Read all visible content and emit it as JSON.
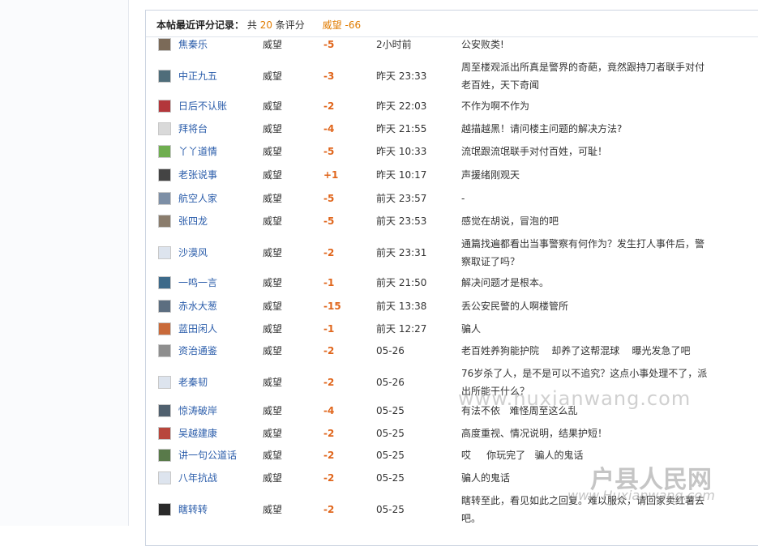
{
  "summary": {
    "label": "本帖最近评分记录：",
    "prefix": "共",
    "count": "20",
    "suffix": "条评分",
    "score_label": "威望",
    "score_total": "-66"
  },
  "records": [
    {
      "user": "焦秦乐",
      "type": "威望",
      "value": "-5",
      "time": "2小时前",
      "reason": "公安败类!",
      "avatar": "#7b6a58"
    },
    {
      "user": "中正九五",
      "type": "威望",
      "value": "-3",
      "time": "昨天 23:33",
      "reason": "周至楼观派出所真是警界的奇葩，竟然跟持刀者联手对付老百姓，天下奇闻",
      "avatar": "#4f6d7a"
    },
    {
      "user": "日后不认账",
      "type": "威望",
      "value": "-2",
      "time": "昨天 22:03",
      "reason": "不作为啊不作为",
      "avatar": "#b3373b"
    },
    {
      "user": "拜将台",
      "type": "威望",
      "value": "-4",
      "time": "昨天 21:55",
      "reason": "越描越黑！请问楼主问题的解决方法?",
      "avatar": "#d9d9d9"
    },
    {
      "user": "丫丫道情",
      "type": "威望",
      "value": "-5",
      "time": "昨天 10:33",
      "reason": "流氓跟流氓联手对付百姓，可耻！",
      "avatar": "#6fae4f"
    },
    {
      "user": "老张说事",
      "type": "威望",
      "value": "+1",
      "time": "昨天 10:17",
      "reason": "声援绪刚观天",
      "avatar": "#444444"
    },
    {
      "user": "航空人家",
      "type": "威望",
      "value": "-5",
      "time": "前天 23:57",
      "reason": "-",
      "avatar": "#7d8fa6"
    },
    {
      "user": "张四龙",
      "type": "威望",
      "value": "-5",
      "time": "前天 23:53",
      "reason": "感觉在胡说，冒泡的吧",
      "avatar": "#8a7c6c"
    },
    {
      "user": "沙漠风",
      "type": "威望",
      "value": "-2",
      "time": "前天 23:31",
      "reason": "通篇找遍都看出当事警察有何作为？发生打人事件后，警察取证了吗？",
      "avatar": "#dde4ee"
    },
    {
      "user": "一鸣一言",
      "type": "威望",
      "value": "-1",
      "time": "前天 21:50",
      "reason": "解决问题才是根本。",
      "avatar": "#3d6a8a"
    },
    {
      "user": "赤水大葱",
      "type": "威望",
      "value": "-15",
      "time": "前天 13:38",
      "reason": "丢公安民警的人啊楼管所",
      "avatar": "#5c6e80"
    },
    {
      "user": "蓝田闲人",
      "type": "威望",
      "value": "-1",
      "time": "前天 12:27",
      "reason": "骗人",
      "avatar": "#c96a3a"
    },
    {
      "user": "资治通鉴",
      "type": "威望",
      "value": "-2",
      "time": "05-26",
      "reason": "老百姓养狗能护院    却养了这帮混球    曝光发急了吧",
      "avatar": "#8e8e8e"
    },
    {
      "user": "老秦韧",
      "type": "威望",
      "value": "-2",
      "time": "05-26",
      "reason": "76岁杀了人，是不是可以不追究？这点小事处理不了，派出所能干什么？",
      "avatar": "#dde4ee"
    },
    {
      "user": "惊涛破岸",
      "type": "威望",
      "value": "-4",
      "time": "05-25",
      "reason": "有法不依   难怪周至这么乱",
      "avatar": "#50606e"
    },
    {
      "user": "吴越建康",
      "type": "威望",
      "value": "-2",
      "time": "05-25",
      "reason": "高度重视、情况说明，结果护短！",
      "avatar": "#b8463c"
    },
    {
      "user": "讲一句公道话",
      "type": "威望",
      "value": "-2",
      "time": "05-25",
      "reason": "哎     你玩完了   骗人的鬼话",
      "avatar": "#597a4a"
    },
    {
      "user": "八年抗战",
      "type": "威望",
      "value": "-2",
      "time": "05-25",
      "reason": "骗人的鬼话",
      "avatar": "#dde4ee"
    },
    {
      "user": "瞎转转",
      "type": "威望",
      "value": "-2",
      "time": "05-25",
      "reason": "瞎转至此，看见如此之回复。难以服众，请回家卖红薯去吧。",
      "avatar": "#2a2a2a"
    }
  ],
  "watermarks": {
    "url_small": "www.huxianwang.com",
    "site_name": "户县人民网",
    "site_url": "www.Huxianwang.com"
  }
}
